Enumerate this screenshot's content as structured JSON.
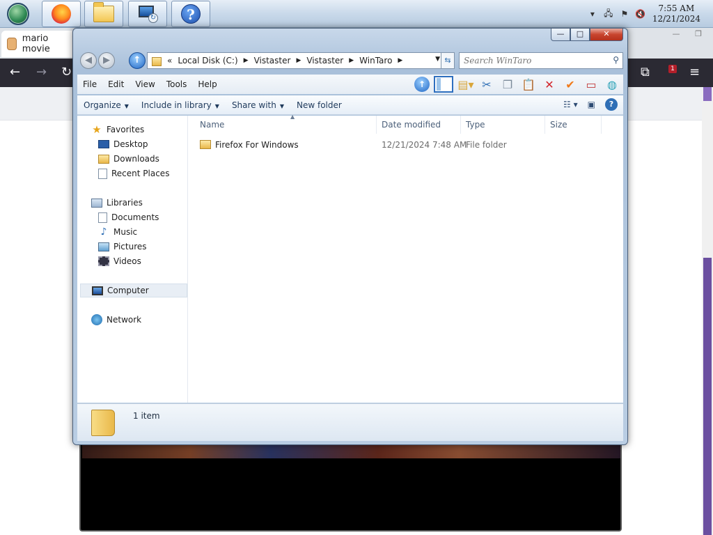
{
  "taskbar": {
    "buttons": [
      {
        "icon": "firefox-icon"
      },
      {
        "icon": "explorer-folder-icon"
      },
      {
        "icon": "remote-desktop-icon"
      },
      {
        "icon": "help-icon"
      }
    ],
    "clock": {
      "time": "7:55 AM",
      "date": "12/21/2024"
    }
  },
  "browser": {
    "tab_title": "mario movie",
    "badge_count": "1"
  },
  "explorer": {
    "address": {
      "overflow": "«",
      "crumbs": [
        "Local Disk (C:)",
        "Vistaster",
        "Vistaster",
        "WinTaro"
      ]
    },
    "search_placeholder": "Search WinTaro",
    "menu": [
      "File",
      "Edit",
      "View",
      "Tools",
      "Help"
    ],
    "commands": [
      "Organize",
      "Include in library",
      "Share with",
      "New folder"
    ],
    "nav": {
      "favorites": "Favorites",
      "desktop": "Desktop",
      "downloads": "Downloads",
      "recent": "Recent Places",
      "libraries": "Libraries",
      "documents": "Documents",
      "music": "Music",
      "pictures": "Pictures",
      "videos": "Videos",
      "computer": "Computer",
      "network": "Network"
    },
    "columns": {
      "name": "Name",
      "date": "Date modified",
      "type": "Type",
      "size": "Size"
    },
    "files": [
      {
        "name": "Firefox For Windows",
        "date": "12/21/2024 7:48 AM",
        "type": "File folder",
        "size": ""
      }
    ],
    "status": "1 item"
  }
}
